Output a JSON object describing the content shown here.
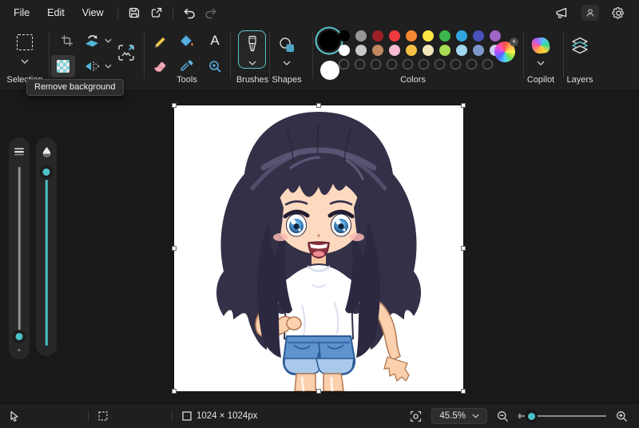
{
  "menubar": {
    "items": [
      "File",
      "Edit",
      "View"
    ]
  },
  "ribbon": {
    "select_label": "Selection",
    "tools_label": "Tools",
    "text_tool_glyph": "A",
    "brushes_label": "Brushes",
    "shapes_label": "Shapes",
    "colors_label": "Colors",
    "copilot_label": "Copilot",
    "layers_label": "Layers"
  },
  "tooltip": {
    "text": "Remove background"
  },
  "colors": {
    "accent": "#4cc2c8",
    "foreground": "#000000",
    "background": "#ffffff",
    "palette": [
      [
        "#000000",
        "#979797",
        "#9c1f23",
        "#ee3a3d",
        "#f58733",
        "#fbe843",
        "#3cb84d",
        "#30a5e0",
        "#4952bb",
        "#9e64c6"
      ],
      [
        "#ffffff",
        "#c9c9c9",
        "#bf8860",
        "#f7bcd4",
        "#f6c244",
        "#f2e7bb",
        "#a8dc53",
        "#a3d7ee",
        "#7e98cb",
        "#c8cdee"
      ]
    ],
    "empty_slots": 10
  },
  "statusbar": {
    "canvas_size": "1024 × 1024px",
    "zoom_value": "45.5%"
  }
}
